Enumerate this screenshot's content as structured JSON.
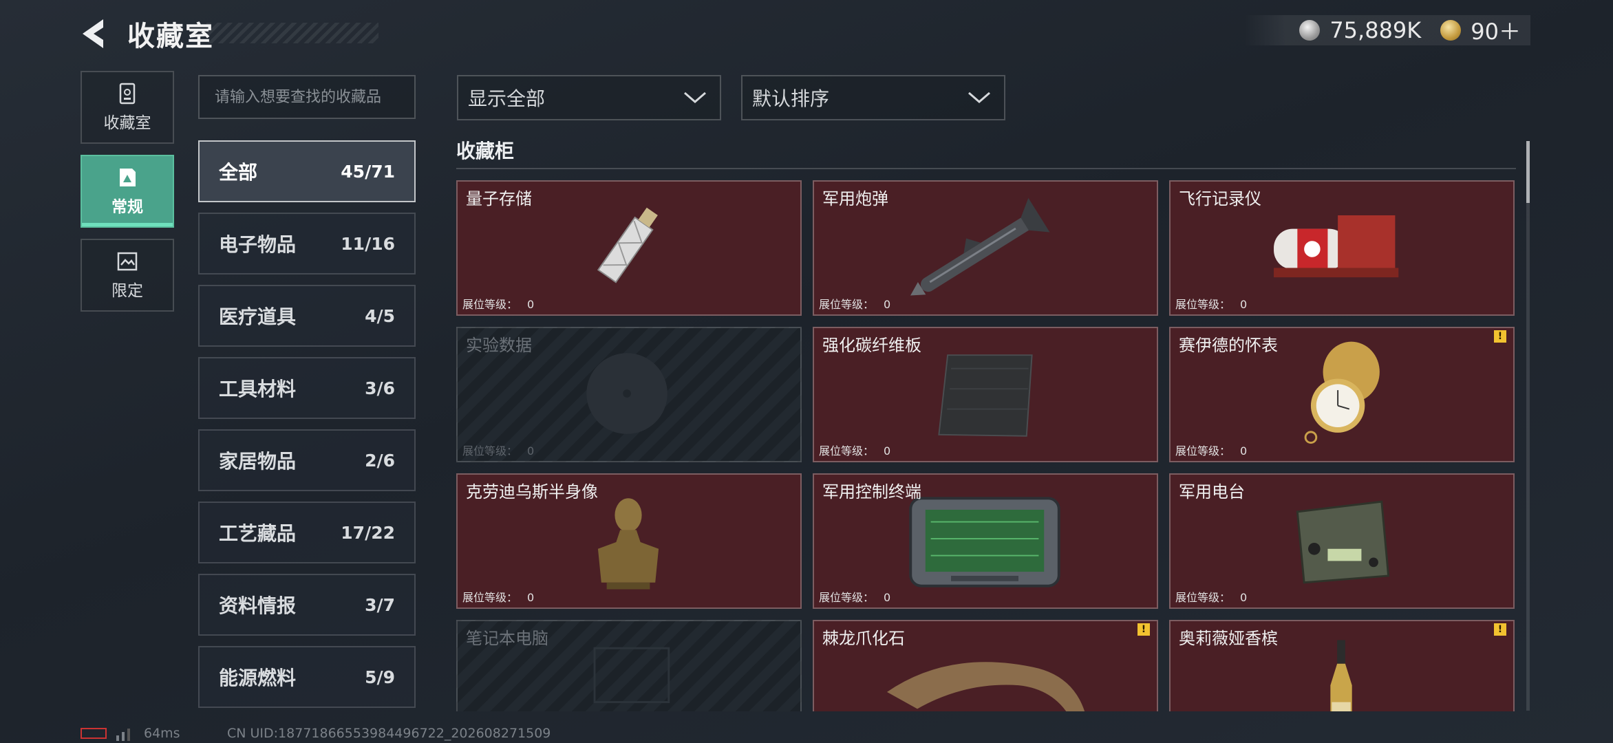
{
  "header": {
    "title": "收藏室"
  },
  "currency": [
    {
      "icon": "silver-coin-icon",
      "value": "75,889K"
    },
    {
      "icon": "gold-coin-icon",
      "value": "90＋"
    }
  ],
  "side_tabs": [
    {
      "label": "收藏室",
      "icon": "collection-room-icon"
    },
    {
      "label": "常规",
      "icon": "regular-icon"
    },
    {
      "label": "限定",
      "icon": "limited-icon"
    }
  ],
  "search": {
    "placeholder": "请输入想要查找的收藏品"
  },
  "categories": [
    {
      "name": "全部",
      "count": "45/71"
    },
    {
      "name": "电子物品",
      "count": "11/16"
    },
    {
      "name": "医疗道具",
      "count": "4/5"
    },
    {
      "name": "工具材料",
      "count": "3/6"
    },
    {
      "name": "家居物品",
      "count": "2/6"
    },
    {
      "name": "工艺藏品",
      "count": "17/22"
    },
    {
      "name": "资料情报",
      "count": "3/7"
    },
    {
      "name": "能源燃料",
      "count": "5/9"
    }
  ],
  "filters": {
    "show": "显示全部",
    "sort": "默认排序"
  },
  "section_title": "收藏柜",
  "level_label": "展位等级：",
  "items": [
    {
      "name": "量子存储",
      "level": "0",
      "locked": false,
      "warning": false
    },
    {
      "name": "军用炮弹",
      "level": "0",
      "locked": false,
      "warning": false
    },
    {
      "name": "飞行记录仪",
      "level": "0",
      "locked": false,
      "warning": false
    },
    {
      "name": "实验数据",
      "level": "0",
      "locked": true,
      "warning": false
    },
    {
      "name": "强化碳纤维板",
      "level": "0",
      "locked": false,
      "warning": false
    },
    {
      "name": "赛伊德的怀表",
      "level": "0",
      "locked": false,
      "warning": true
    },
    {
      "name": "克劳迪乌斯半身像",
      "level": "0",
      "locked": false,
      "warning": false
    },
    {
      "name": "军用控制终端",
      "level": "0",
      "locked": false,
      "warning": false
    },
    {
      "name": "军用电台",
      "level": "0",
      "locked": false,
      "warning": false
    },
    {
      "name": "笔记本电脑",
      "level": "",
      "locked": true,
      "warning": false
    },
    {
      "name": "棘龙爪化石",
      "level": "",
      "locked": false,
      "warning": true
    },
    {
      "name": "奥莉薇娅香槟",
      "level": "",
      "locked": false,
      "warning": true
    }
  ],
  "footer": {
    "ping": "64ms",
    "uid": "CN UID:18771866553984496722_202608271509"
  }
}
